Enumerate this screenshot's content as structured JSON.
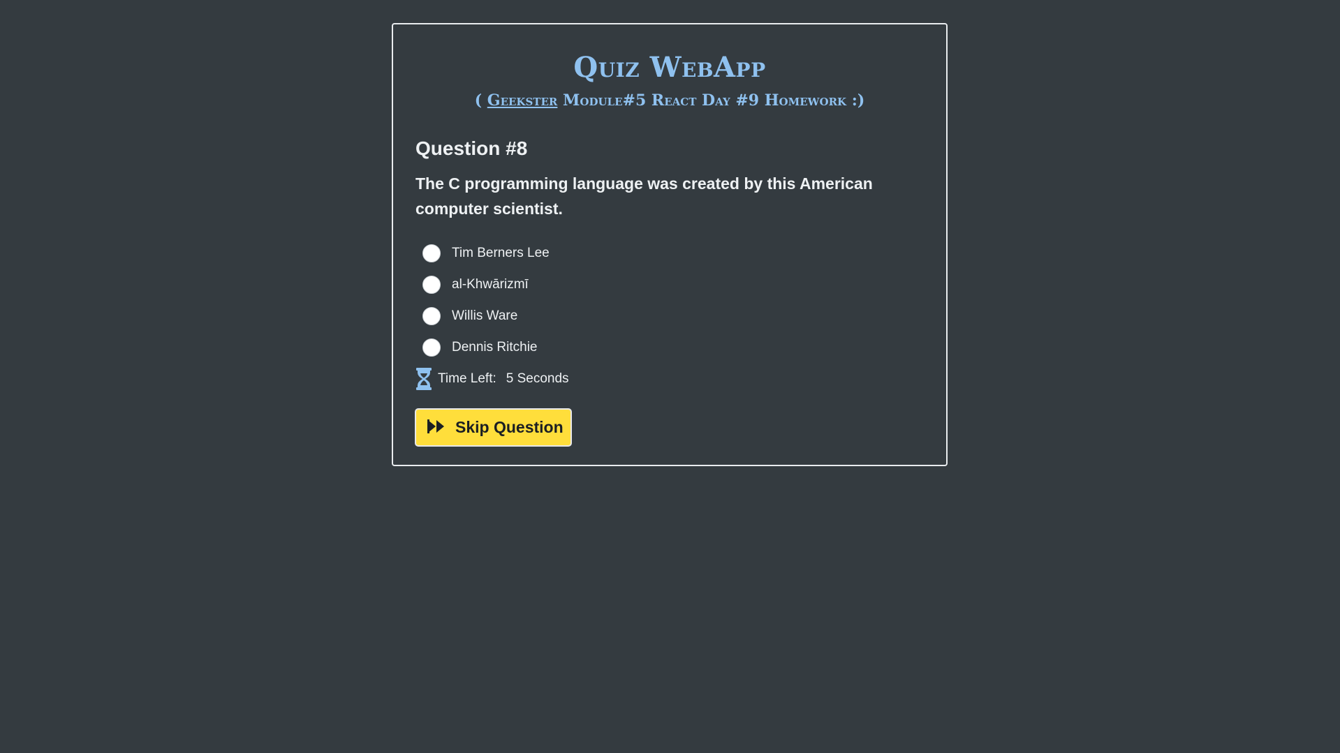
{
  "header": {
    "title": "Quiz WebApp",
    "subtitle_open": "( ",
    "subtitle_link": "Geekster",
    "subtitle_rest": " Module#5 React Day #9 Homework :)"
  },
  "question": {
    "heading": "Question #8",
    "text": "The C programming language was created by this American computer scientist.",
    "options": [
      {
        "label": "Tim Berners Lee"
      },
      {
        "label": "al-Khwārizmī"
      },
      {
        "label": "Willis Ware"
      },
      {
        "label": "Dennis Ritchie"
      }
    ]
  },
  "timer": {
    "icon": "hourglass-icon",
    "label": "Time Left:",
    "value": "5 Seconds"
  },
  "skip": {
    "icon": "fast-forward-icon",
    "label": "Skip Question"
  },
  "colors": {
    "background": "#343b40",
    "accent": "#8fc1ef",
    "button": "#ffde3b"
  }
}
